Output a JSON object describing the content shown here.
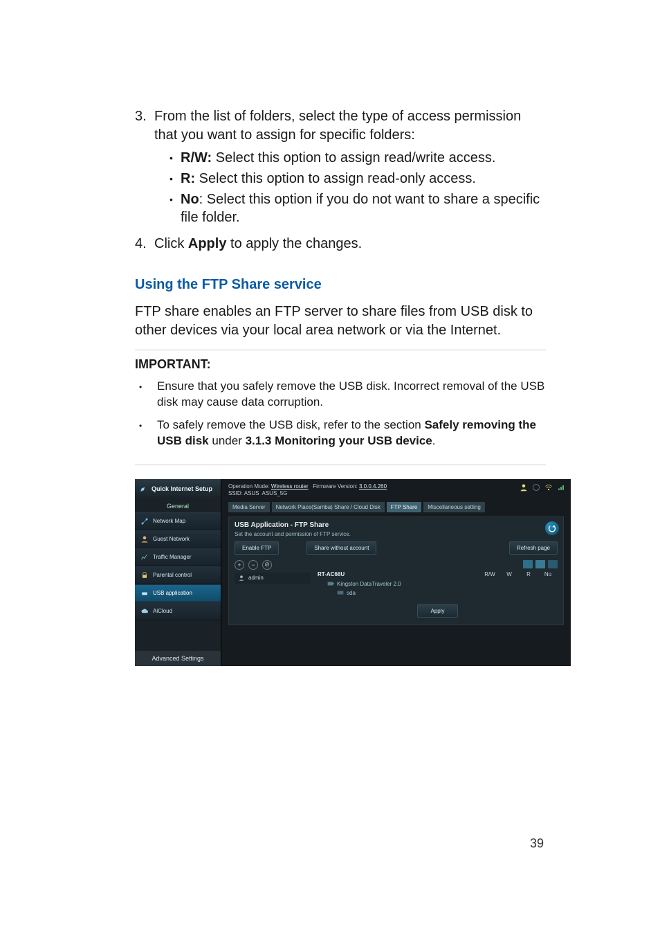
{
  "step3": {
    "num": "3.",
    "text": "From the list of folders, select the type of access permission that you want to assign for specific folders:",
    "items": [
      {
        "label": "R/W:",
        "text": "  Select this option to assign read/write access."
      },
      {
        "label": "R:",
        "text": "  Select this option to assign read-only access."
      },
      {
        "label": "No",
        "colon": ":",
        "text": "  Select this option if you do not want to share a specific file folder."
      }
    ]
  },
  "step4": {
    "num": "4.",
    "text_pre": "Click ",
    "text_b": "Apply",
    "text_post": " to apply the changes."
  },
  "ftp": {
    "heading": "Using the FTP Share service",
    "para": "FTP share enables an FTP server to share files from USB disk to other devices via your local area network or via the Internet."
  },
  "important": {
    "title": "IMPORTANT",
    "colon": ":",
    "items": [
      {
        "pre": "Ensure that you safely remove the USB disk. Incorrect removal of the USB disk may cause data corruption."
      },
      {
        "pre": "To safely remove the USB disk, refer to the section ",
        "b1": "Safely removing the USB disk",
        "mid": " under ",
        "b2": "3.1.3 Monitoring your USB device",
        "post": "."
      }
    ]
  },
  "ui": {
    "sidebar": {
      "qis": "Quick Internet Setup",
      "general": "General",
      "items": [
        "Network Map",
        "Guest Network",
        "Traffic Manager",
        "Parental control",
        "USB application",
        "AiCloud"
      ],
      "advanced": "Advanced Settings"
    },
    "top": {
      "modeLabel": "Operation Mode:",
      "mode": "Wireless router",
      "fwLabel": "Firmware Version:",
      "fw": "3.0.0.4.260",
      "ssidLabel": "SSID:",
      "ssid1": "ASUS",
      "ssid2": "ASUS_5G"
    },
    "tabs": [
      "Media Server",
      "Network Place(Samba) Share / Cloud Disk",
      "FTP Share",
      "Miscellaneous setting"
    ],
    "panel": {
      "title": "USB Application - FTP Share",
      "sub": "Set the account and permission of FTP service.",
      "enable": "Enable FTP",
      "share": "Share without account",
      "refresh": "Refresh page",
      "acct": "admin",
      "device": "RT-AC66U",
      "usb": "Kingston DataTraveler 2.0",
      "sda": "sda",
      "cols": {
        "rw": "R/W",
        "w": "W",
        "r": "R",
        "no": "No"
      },
      "apply": "Apply"
    }
  },
  "pagenum": "39"
}
